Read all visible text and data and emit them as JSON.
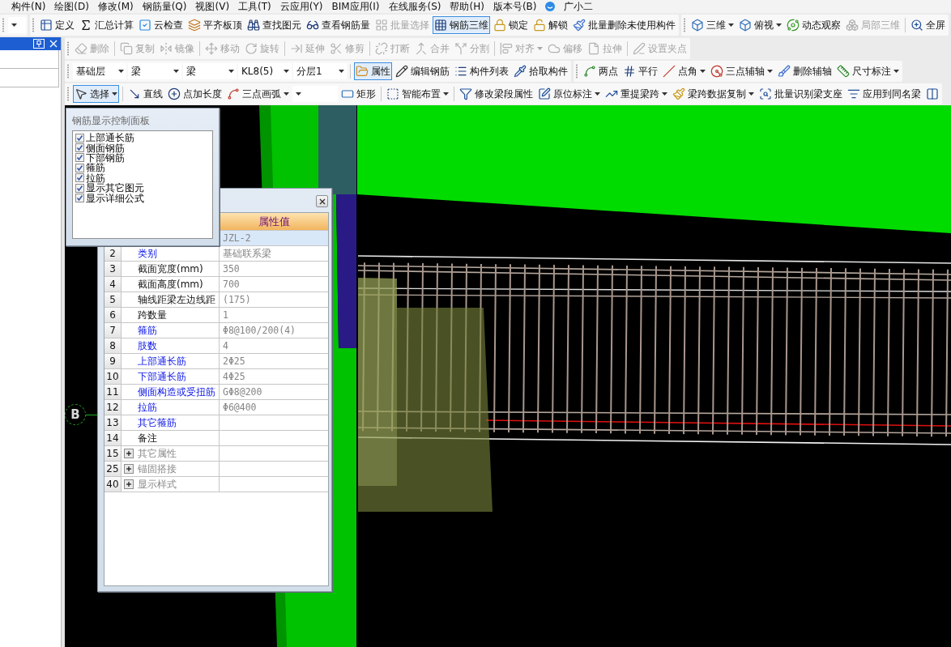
{
  "menu": [
    "构件(N)",
    "绘图(D)",
    "修改(M)",
    "钢筋量(Q)",
    "视图(V)",
    "工具(T)",
    "云应用(Y)",
    "BIM应用(I)",
    "在线服务(S)",
    "帮助(H)",
    "版本号(B)"
  ],
  "assistant": "广小二",
  "toolbar_rows": [
    {
      "toolbars": [
        {
          "groups": [
            [
              {
                "kind": "combo"
              }
            ]
          ]
        },
        {
          "groups": [
            [
              {
                "kind": "button",
                "label": "定义",
                "disabled": false,
                "pressed": false,
                "dropdown": false
              },
              {
                "kind": "button",
                "label": "汇总计算",
                "disabled": false,
                "pressed": false,
                "dropdown": false
              },
              {
                "kind": "button",
                "label": "云检查",
                "disabled": false,
                "pressed": false,
                "dropdown": false
              },
              {
                "kind": "button",
                "label": "平齐板顶",
                "disabled": false,
                "pressed": false,
                "dropdown": false
              },
              {
                "kind": "button",
                "label": "查找图元",
                "disabled": false,
                "pressed": false,
                "dropdown": false
              },
              {
                "kind": "button",
                "label": "查看钢筋量",
                "disabled": false,
                "pressed": false,
                "dropdown": false
              },
              {
                "kind": "button",
                "label": "批量选择",
                "disabled": true,
                "pressed": false,
                "dropdown": false
              },
              {
                "kind": "button",
                "label": "钢筋三维",
                "disabled": false,
                "pressed": true,
                "dropdown": false
              },
              {
                "kind": "button",
                "label": "锁定",
                "disabled": false,
                "pressed": false,
                "dropdown": false
              },
              {
                "kind": "button",
                "label": "解锁",
                "disabled": false,
                "pressed": false,
                "dropdown": false
              },
              {
                "kind": "button",
                "label": "批量删除未使用构件",
                "disabled": false,
                "pressed": false,
                "dropdown": false
              }
            ]
          ]
        },
        {
          "groups": [
            [
              {
                "kind": "button",
                "label": "三维",
                "disabled": false,
                "pressed": false,
                "dropdown": true
              },
              {
                "kind": "button",
                "label": "俯视",
                "disabled": false,
                "pressed": false,
                "dropdown": true
              },
              {
                "kind": "button",
                "label": "动态观察",
                "disabled": false,
                "pressed": false,
                "dropdown": false
              },
              {
                "kind": "button",
                "label": "局部三维",
                "disabled": true,
                "pressed": false,
                "dropdown": false
              }
            ],
            [
              {
                "kind": "button",
                "label": "全屏",
                "disabled": false,
                "pressed": false,
                "dropdown": false
              }
            ]
          ]
        }
      ]
    },
    {
      "toolbars": [
        {
          "groups": [
            [
              {
                "kind": "button",
                "label": "删除",
                "disabled": true,
                "pressed": false,
                "dropdown": false
              }
            ],
            [
              {
                "kind": "button",
                "label": "复制",
                "disabled": true,
                "pressed": false,
                "dropdown": false
              },
              {
                "kind": "button",
                "label": "镜像",
                "disabled": true,
                "pressed": false,
                "dropdown": false
              }
            ],
            [
              {
                "kind": "button",
                "label": "移动",
                "disabled": true,
                "pressed": false,
                "dropdown": false
              },
              {
                "kind": "button",
                "label": "旋转",
                "disabled": true,
                "pressed": false,
                "dropdown": false
              }
            ],
            [
              {
                "kind": "button",
                "label": "延伸",
                "disabled": true,
                "pressed": false,
                "dropdown": false
              },
              {
                "kind": "button",
                "label": "修剪",
                "disabled": true,
                "pressed": false,
                "dropdown": false
              }
            ],
            [
              {
                "kind": "button",
                "label": "打断",
                "disabled": true,
                "pressed": false,
                "dropdown": false
              },
              {
                "kind": "button",
                "label": "合并",
                "disabled": true,
                "pressed": false,
                "dropdown": false
              },
              {
                "kind": "button",
                "label": "分割",
                "disabled": true,
                "pressed": false,
                "dropdown": false
              }
            ],
            [
              {
                "kind": "button",
                "label": "对齐",
                "disabled": true,
                "pressed": false,
                "dropdown": true
              },
              {
                "kind": "button",
                "label": "偏移",
                "disabled": true,
                "pressed": false,
                "dropdown": false
              },
              {
                "kind": "button",
                "label": "拉伸",
                "disabled": true,
                "pressed": false,
                "dropdown": false
              }
            ],
            [
              {
                "kind": "button",
                "label": "设置夹点",
                "disabled": true,
                "pressed": false,
                "dropdown": false
              }
            ]
          ]
        }
      ]
    },
    {
      "toolbars": [
        {
          "groups": [
            [
              {
                "kind": "combo",
                "value": "基础层"
              },
              {
                "kind": "combo",
                "value": "梁"
              },
              {
                "kind": "combo",
                "value": "梁"
              },
              {
                "kind": "combo",
                "value": "KL8(5)"
              },
              {
                "kind": "combo",
                "value": "分层1"
              }
            ],
            [
              {
                "kind": "button",
                "label": "属性",
                "disabled": false,
                "pressed": true,
                "dropdown": false
              },
              {
                "kind": "button",
                "label": "编辑钢筋",
                "disabled": false,
                "pressed": false,
                "dropdown": false
              },
              {
                "kind": "button",
                "label": "构件列表",
                "disabled": false,
                "pressed": false,
                "dropdown": false
              },
              {
                "kind": "button",
                "label": "拾取构件",
                "disabled": false,
                "pressed": false,
                "dropdown": false
              }
            ]
          ]
        },
        {
          "groups": [
            [
              {
                "kind": "button",
                "label": "两点",
                "disabled": false,
                "pressed": false,
                "dropdown": false
              },
              {
                "kind": "button",
                "label": "平行",
                "disabled": false,
                "pressed": false,
                "dropdown": false
              },
              {
                "kind": "button",
                "label": "点角",
                "disabled": false,
                "pressed": false,
                "dropdown": true
              },
              {
                "kind": "button",
                "label": "三点辅轴",
                "disabled": false,
                "pressed": false,
                "dropdown": true
              },
              {
                "kind": "button",
                "label": "删除辅轴",
                "disabled": false,
                "pressed": false,
                "dropdown": false
              },
              {
                "kind": "button",
                "label": "尺寸标注",
                "disabled": false,
                "pressed": false,
                "dropdown": true
              }
            ]
          ]
        }
      ]
    },
    {
      "toolbars": [
        {
          "groups": [
            [
              {
                "kind": "button",
                "label": "选择",
                "disabled": false,
                "pressed": true,
                "dropdown": true
              }
            ],
            [
              {
                "kind": "button",
                "label": "直线",
                "disabled": false,
                "pressed": false,
                "dropdown": false
              },
              {
                "kind": "button",
                "label": "点加长度",
                "disabled": false,
                "pressed": false,
                "dropdown": false
              },
              {
                "kind": "button",
                "label": "三点画弧",
                "disabled": false,
                "pressed": false,
                "dropdown": true
              },
              {
                "kind": "combo"
              },
              {
                "kind": "button",
                "label": "矩形",
                "disabled": false,
                "pressed": false,
                "dropdown": false
              }
            ],
            [
              {
                "kind": "button",
                "label": "智能布置",
                "disabled": false,
                "pressed": false,
                "dropdown": true
              }
            ],
            [
              {
                "kind": "button",
                "label": "修改梁段属性",
                "disabled": false,
                "pressed": false,
                "dropdown": false
              },
              {
                "kind": "button",
                "label": "原位标注",
                "disabled": false,
                "pressed": false,
                "dropdown": true
              },
              {
                "kind": "button",
                "label": "重提梁跨",
                "disabled": false,
                "pressed": false,
                "dropdown": true
              },
              {
                "kind": "button",
                "label": "梁跨数据复制",
                "disabled": false,
                "pressed": false,
                "dropdown": true
              },
              {
                "kind": "button",
                "label": "批量识别梁支座",
                "disabled": false,
                "pressed": false,
                "dropdown": false
              },
              {
                "kind": "button",
                "label": "应用到同名梁",
                "disabled": false,
                "pressed": false,
                "dropdown": false
              },
              {
                "kind": "button",
                "disabled": false,
                "pressed": false,
                "dropdown": false
              }
            ]
          ]
        }
      ]
    }
  ],
  "display_panel": {
    "title": "钢筋显示控制面板",
    "items": [
      {
        "label": "上部通长筋",
        "checked": true
      },
      {
        "label": "侧面钢筋",
        "checked": true
      },
      {
        "label": "下部钢筋",
        "checked": true
      },
      {
        "label": "箍筋",
        "checked": true
      },
      {
        "label": "拉筋",
        "checked": true
      },
      {
        "label": "显示其它图元",
        "checked": true
      },
      {
        "label": "显示详细公式",
        "checked": true
      }
    ]
  },
  "property_panel": {
    "header": "属性值",
    "rows": [
      {
        "value": "JZL-2",
        "selected": true
      },
      {
        "number": "2",
        "name": "类别",
        "kind": "public",
        "value": "基础联系梁",
        "selected": false
      },
      {
        "number": "3",
        "name": "截面宽度(mm)",
        "kind": "private",
        "value": "350",
        "selected": false
      },
      {
        "number": "4",
        "name": "截面高度(mm)",
        "kind": "private",
        "value": "700",
        "selected": false
      },
      {
        "number": "5",
        "name": "轴线距梁左边线距",
        "kind": "private",
        "value": "(175)",
        "selected": false
      },
      {
        "number": "6",
        "name": "跨数量",
        "kind": "private",
        "value": "1",
        "selected": false
      },
      {
        "number": "7",
        "name": "箍筋",
        "kind": "public",
        "value": "Φ8@100/200(4)",
        "selected": false
      },
      {
        "number": "8",
        "name": "肢数",
        "kind": "public",
        "value": "4",
        "selected": false
      },
      {
        "number": "9",
        "name": "上部通长筋",
        "kind": "public",
        "value": "2Φ25",
        "selected": false
      },
      {
        "number": "10",
        "name": "下部通长筋",
        "kind": "public",
        "value": "4Φ25",
        "selected": false
      },
      {
        "number": "11",
        "name": "侧面构造或受扭筋",
        "kind": "public",
        "value": "GΦ8@200",
        "selected": false
      },
      {
        "number": "12",
        "name": "拉筋",
        "kind": "public",
        "value": "Φ6@400",
        "selected": false
      },
      {
        "number": "13",
        "name": "其它箍筋",
        "kind": "public",
        "selected": false
      },
      {
        "number": "14",
        "name": "备注",
        "kind": "private",
        "selected": false
      },
      {
        "number": "15",
        "name": "其它属性",
        "kind": "group",
        "expanded": false,
        "selected": false
      },
      {
        "number": "25",
        "name": "锚固搭接",
        "kind": "group",
        "expanded": false,
        "selected": false
      },
      {
        "number": "40",
        "name": "显示样式",
        "kind": "group",
        "expanded": false,
        "selected": false
      }
    ]
  },
  "viewport": {
    "axis_label": "B"
  }
}
